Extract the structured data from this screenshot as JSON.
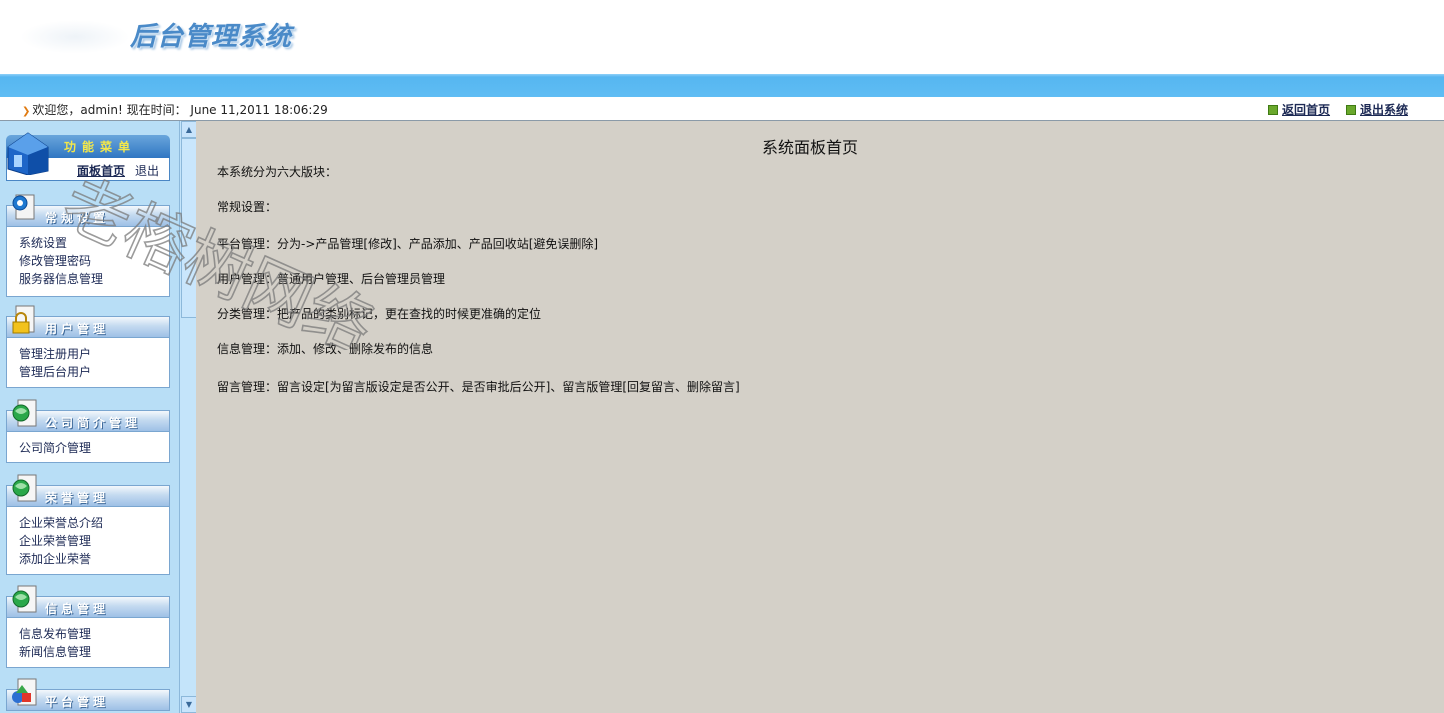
{
  "header": {
    "logo_text": "后台管理系统"
  },
  "status": {
    "welcome": "欢迎您，admin! 现在时间： June 11,2011 18:06:29",
    "back_home": "返回首页",
    "logout": "退出系统"
  },
  "menu": {
    "title": "功能菜单",
    "home": "面板首页",
    "logout": "退出"
  },
  "groups": [
    {
      "title": "常规设置",
      "items": [
        "系统设置",
        "修改管理密码",
        "服务器信息管理"
      ]
    },
    {
      "title": "用户管理",
      "items": [
        "管理注册用户",
        "管理后台用户"
      ]
    },
    {
      "title": "公司简介管理",
      "items": [
        "公司简介管理"
      ]
    },
    {
      "title": "荣誉管理",
      "items": [
        "企业荣誉总介绍",
        "企业荣誉管理",
        "添加企业荣誉"
      ]
    },
    {
      "title": "信息管理",
      "items": [
        "信息发布管理",
        "新闻信息管理"
      ]
    },
    {
      "title": "平台管理",
      "items": []
    }
  ],
  "main": {
    "title": "系统面板首页",
    "lines": [
      "本系统分为六大版块：",
      "常规设置：",
      "平台管理：分为->产品管理[修改]、产品添加、产品回收站[避免误删除]",
      "用户管理：普通用户管理、后台管理员管理",
      "分类管理：把产品的类别标记，更在查找的时候更准确的定位",
      "信息管理：添加、修改、删除发布的信息",
      "留言管理：留言设定[为留言版设定是否公开、是否审批后公开]、留言版管理[回复留言、删除留言]"
    ]
  },
  "watermark": {
    "text": "老榕树网络"
  },
  "colors": {
    "sidebar_bg": "#b8def6",
    "main_bg": "#d4d0c8",
    "band": "#5fbdf4",
    "menu_bar": "#2f76c2"
  }
}
